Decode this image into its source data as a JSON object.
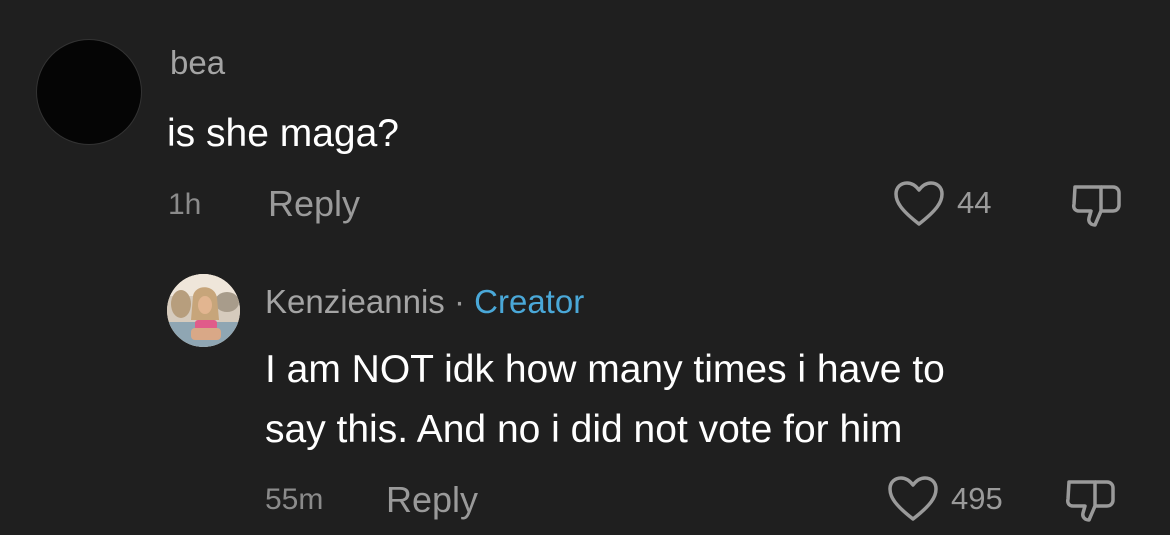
{
  "comments": [
    {
      "username": "bea",
      "text": "is she maga?",
      "time": "1h",
      "reply_label": "Reply",
      "likes": "44"
    },
    {
      "username": "Kenzieannis",
      "separator": "·",
      "badge": "Creator",
      "text_line1": "I am NOT idk how many times i have to",
      "text_line2": "say this. And no i did not vote for him",
      "time": "55m",
      "reply_label": "Reply",
      "likes": "495"
    }
  ],
  "colors": {
    "background": "#1f1f1f",
    "creator_badge": "#4aa8d8",
    "muted_text": "#9a9a9a"
  },
  "icons": [
    "heart-icon",
    "dislike-icon"
  ]
}
